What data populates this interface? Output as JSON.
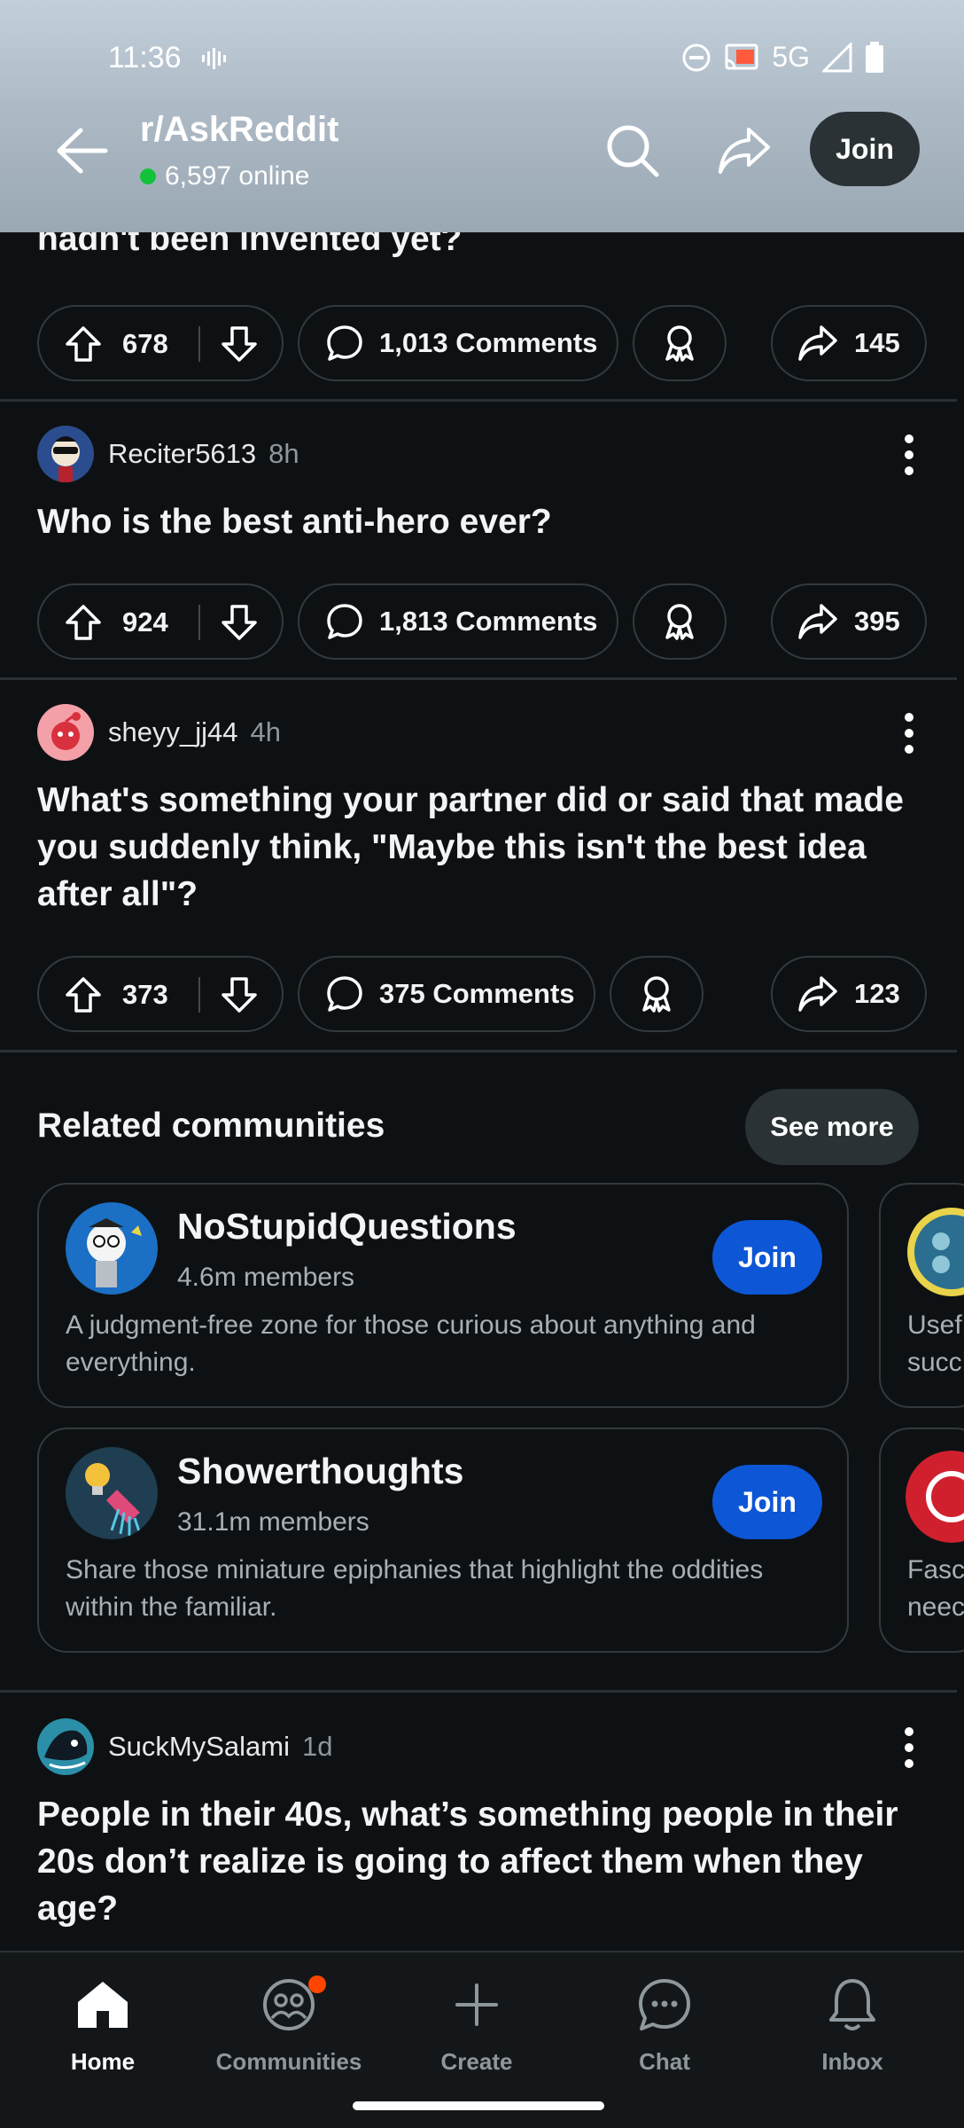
{
  "status_bar": {
    "time": "11:36",
    "network": "5G"
  },
  "header": {
    "subreddit": "r/AskReddit",
    "online": "6,597 online",
    "join_label": "Join"
  },
  "feed": {
    "partial_post": {
      "title_fragment": "hadn't been invented yet?",
      "upvotes": "678",
      "comments": "1,013 Comments",
      "shares": "145"
    },
    "posts": [
      {
        "author": "Reciter5613",
        "age": "8h",
        "title": "Who is the best anti-hero ever?",
        "upvotes": "924",
        "comments": "1,813 Comments",
        "shares": "395"
      },
      {
        "author": "sheyy_jj44",
        "age": "4h",
        "title": "What's something your partner did or said that made you suddenly think, \"Maybe this isn't the best idea after all\"?",
        "upvotes": "373",
        "comments": "375 Comments",
        "shares": "123"
      },
      {
        "author": "SuckMySalami",
        "age": "1d",
        "title": "People in their 40s, what’s something people in their 20s don’t realize is going to affect them when they age?"
      }
    ]
  },
  "related": {
    "title": "Related communities",
    "see_more_label": "See more",
    "communities": [
      {
        "name": "NoStupidQuestions",
        "members": "4.6m members",
        "description": "A judgment-free zone for those curious about anything and everything.",
        "join_label": "Join"
      },
      {
        "name": "Showerthoughts",
        "members": "31.1m members",
        "description": "Share those miniature epiphanies that highlight the oddities within the familiar.",
        "join_label": "Join"
      }
    ],
    "peek": [
      {
        "description_fragment": "Usef\nsucc"
      },
      {
        "description_fragment": "Fasc\nneec"
      }
    ]
  },
  "bottom_nav": {
    "items": [
      {
        "label": "Home",
        "icon": "home-icon",
        "active": true
      },
      {
        "label": "Communities",
        "icon": "communities-icon"
      },
      {
        "label": "Create",
        "icon": "plus-icon"
      },
      {
        "label": "Chat",
        "icon": "chat-icon"
      },
      {
        "label": "Inbox",
        "icon": "bell-icon"
      }
    ]
  },
  "colors": {
    "background": "#0e1113",
    "join_blue": "#0d56d6",
    "online_green": "#12c33a",
    "notification_orange": "#ff4500"
  }
}
